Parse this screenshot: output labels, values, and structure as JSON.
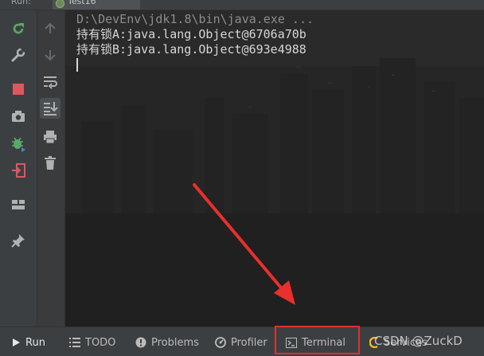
{
  "top": {
    "run_label": "Run:",
    "tab_title": "Test16"
  },
  "console": {
    "command_line": "D:\\DevEnv\\jdk1.8\\bin\\java.exe ...",
    "output": [
      "持有锁A:java.lang.Object@6706a70b",
      "持有锁B:java.lang.Object@693e4988"
    ]
  },
  "left_toolbar": {
    "primary": [
      "rerun-icon",
      "settings-wrench-icon",
      "stop-icon",
      "camera-icon",
      "debug-bug-icon",
      "exit-icon",
      "layout-icon",
      "pin-icon"
    ],
    "secondary": [
      "up-arrow-icon",
      "down-arrow-icon",
      "soft-wrap-icon",
      "scroll-to-end-icon",
      "print-icon",
      "trash-icon"
    ]
  },
  "bottom_bar": {
    "run": "Run",
    "todo": "TODO",
    "problems": "Problems",
    "profiler": "Profiler",
    "terminal": "Terminal",
    "services": "Services"
  },
  "watermark": "CSDN @ZuckD",
  "colors": {
    "background": "#2b2b2b",
    "toolbar": "#3c3f41",
    "highlight_box": "#e0302f",
    "arrow": "#e8302c"
  }
}
